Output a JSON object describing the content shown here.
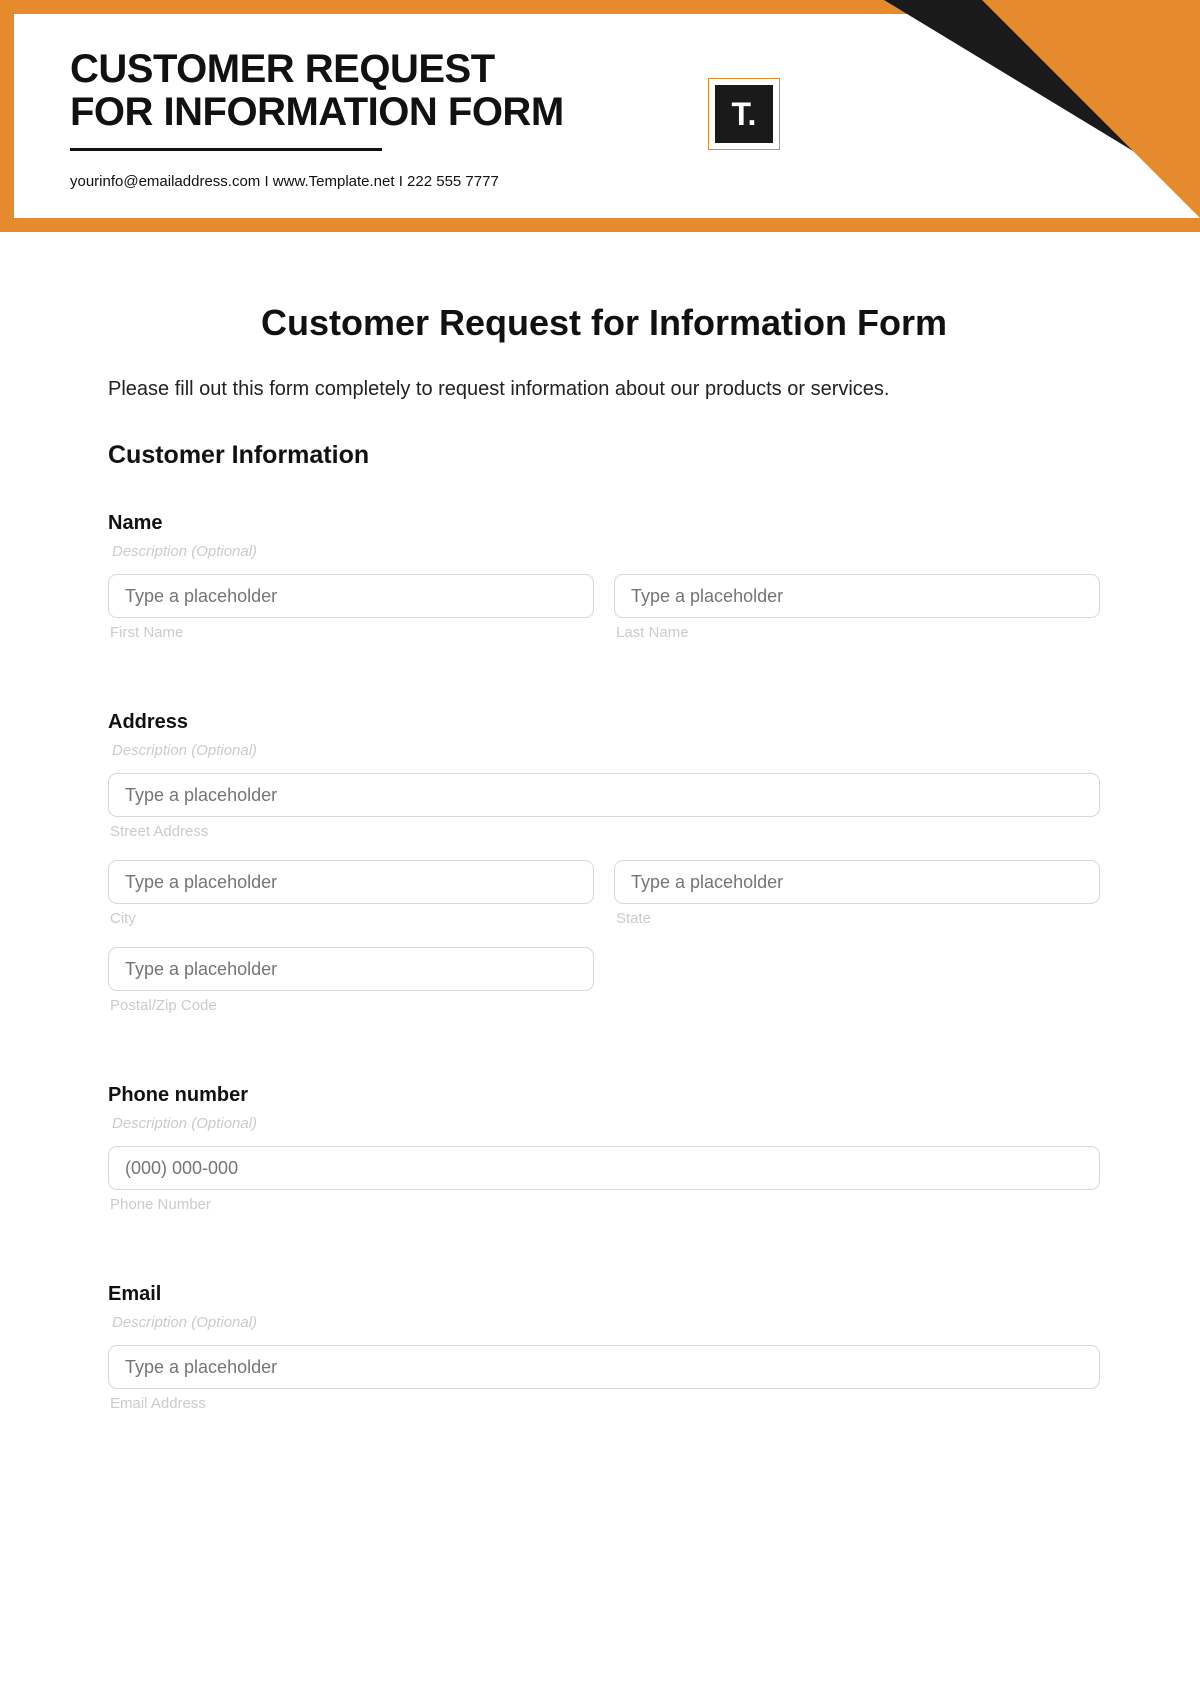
{
  "banner": {
    "title_line1": "CUSTOMER REQUEST",
    "title_line2": "FOR INFORMATION FORM",
    "contact": "yourinfo@emailaddress.com  I  www.Template.net  I  222 555 7777",
    "logo_text": "T."
  },
  "form": {
    "title": "Customer Request for Information Form",
    "intro": "Please fill out this form completely to request information about our products or services.",
    "section_heading": "Customer Information",
    "desc_hint": "Description (Optional)",
    "placeholder_generic": "Type a placeholder",
    "name": {
      "label": "Name",
      "first_sub": "First Name",
      "last_sub": "Last Name"
    },
    "address": {
      "label": "Address",
      "street_sub": "Street Address",
      "city_sub": "City",
      "state_sub": "State",
      "postal_sub": "Postal/Zip Code"
    },
    "phone": {
      "label": "Phone number",
      "placeholder": "(000) 000-000",
      "sub": "Phone Number"
    },
    "email": {
      "label": "Email",
      "sub": "Email Address"
    }
  }
}
